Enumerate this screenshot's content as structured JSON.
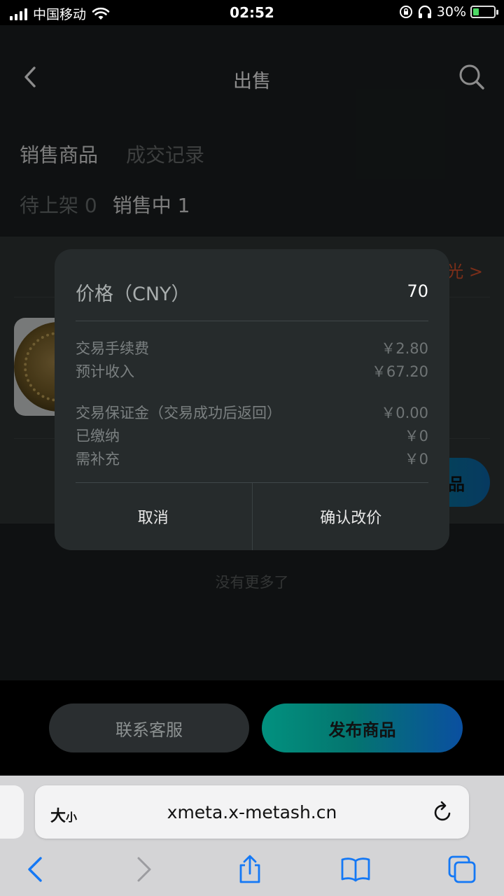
{
  "status_bar": {
    "carrier": "中国移动",
    "time": "02:52",
    "battery": "30%",
    "battery_level": 0.3
  },
  "nav": {
    "title": "出售"
  },
  "tabs": {
    "primary": [
      "销售商品",
      "成交记录"
    ],
    "secondary_pending": "待上架 0",
    "secondary_selling": "销售中 1"
  },
  "list": {
    "item_link": "光 >",
    "item_action": "品",
    "no_more": "没有更多了"
  },
  "dialog": {
    "price_label": "价格（CNY）",
    "price_value": "70",
    "fee_label": "交易手续费",
    "fee_value": "￥2.80",
    "income_label": "预计收入",
    "income_value": "￥67.20",
    "deposit_label": "交易保证金（交易成功后返回）",
    "deposit_value": "￥0.00",
    "paid_label": "已缴纳",
    "paid_value": "￥0",
    "topup_label": "需补充",
    "topup_value": "￥0",
    "cancel": "取消",
    "confirm": "确认改价"
  },
  "bottom": {
    "service": "联系客服",
    "publish": "发布商品"
  },
  "safari": {
    "text_size_big": "大",
    "text_size_small": "小",
    "url": "xmeta.x-metash.cn"
  },
  "colors": {
    "accent_teal": "#02917f",
    "accent_blue": "#0a4fa0",
    "link_orange": "#e0552e"
  }
}
